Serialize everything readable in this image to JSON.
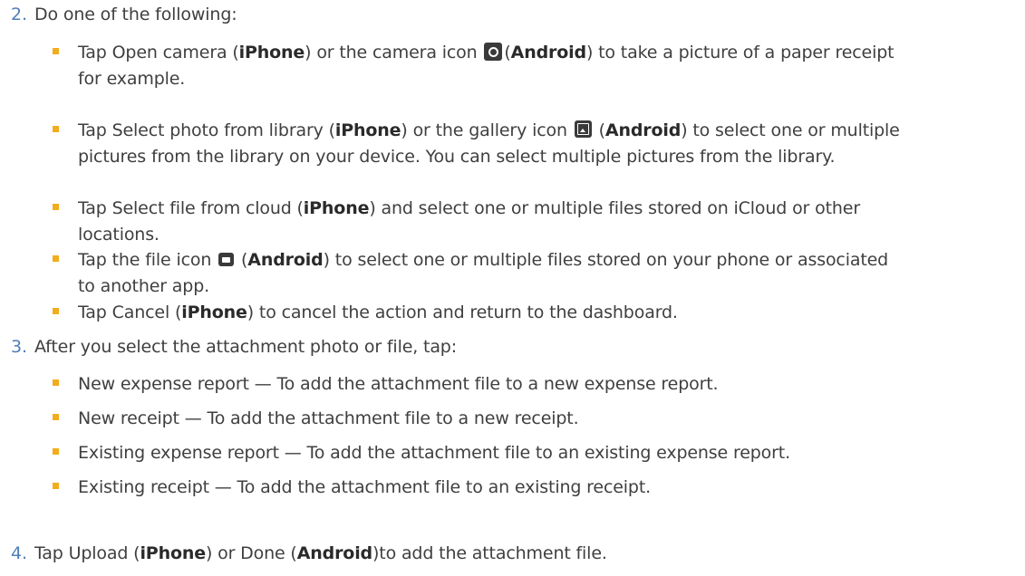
{
  "steps": [
    {
      "number": "2.",
      "text": "Do one of the following:",
      "bullets": [
        {
          "line1": [
            {
              "t": "Tap Open camera ("
            },
            {
              "t": "iPhone",
              "b": true
            },
            {
              "t": ") or the camera icon "
            },
            {
              "icon": "camera-icon"
            },
            {
              "t": "("
            },
            {
              "t": "Android",
              "b": true
            },
            {
              "t": ") to take a picture of a paper receipt"
            }
          ],
          "line2": "for example."
        },
        {
          "line1": [
            {
              "t": "Tap Select photo from library ("
            },
            {
              "t": "iPhone",
              "b": true
            },
            {
              "t": ") or the gallery icon "
            },
            {
              "icon": "gallery-icon"
            },
            {
              "t": " ("
            },
            {
              "t": "Android",
              "b": true
            },
            {
              "t": ") to select one or multiple"
            }
          ],
          "line2": "pictures from the library on your device. You can select multiple pictures from the library."
        },
        {
          "line1": [
            {
              "t": "Tap Select file from cloud ("
            },
            {
              "t": "iPhone",
              "b": true
            },
            {
              "t": ") and select one or multiple files stored on iCloud or other"
            }
          ],
          "line2": "locations."
        },
        {
          "line1": [
            {
              "t": "Tap the file icon "
            },
            {
              "icon": "file-icon"
            },
            {
              "t": " ("
            },
            {
              "t": "Android",
              "b": true
            },
            {
              "t": ") to select one or multiple files stored on your phone or associated"
            }
          ],
          "line2": "to another app."
        },
        {
          "line1": [
            {
              "t": "Tap Cancel ("
            },
            {
              "t": "iPhone",
              "b": true
            },
            {
              "t": ") to cancel the action and return to the dashboard."
            }
          ],
          "line2": ""
        }
      ]
    },
    {
      "number": "3.",
      "text": "After you select the attachment photo or file, tap:",
      "bullets": [
        {
          "line1": [
            {
              "t": "New expense report — To add the attachment file to a new expense report."
            }
          ],
          "line2": ""
        },
        {
          "line1": [
            {
              "t": "New receipt — To add the attachment file to a new receipt."
            }
          ],
          "line2": ""
        },
        {
          "line1": [
            {
              "t": "Existing expense report — To add the attachment file to an existing expense report."
            }
          ],
          "line2": ""
        },
        {
          "line1": [
            {
              "t": "Existing receipt — To add the attachment file to an existing receipt."
            }
          ],
          "line2": ""
        }
      ]
    },
    {
      "number": "4.",
      "text_parts": [
        {
          "t": "Tap Upload ("
        },
        {
          "t": "iPhone",
          "b": true
        },
        {
          "t": ") or Done ("
        },
        {
          "t": "Android",
          "b": true
        },
        {
          "t": ")to add the attachment file."
        }
      ],
      "bullets": []
    }
  ],
  "colors": {
    "step_number": "#4f7fb8",
    "bullet": "#f2ad1c",
    "text": "#3f3f3f",
    "icon_bg": "#3a3a3a"
  }
}
